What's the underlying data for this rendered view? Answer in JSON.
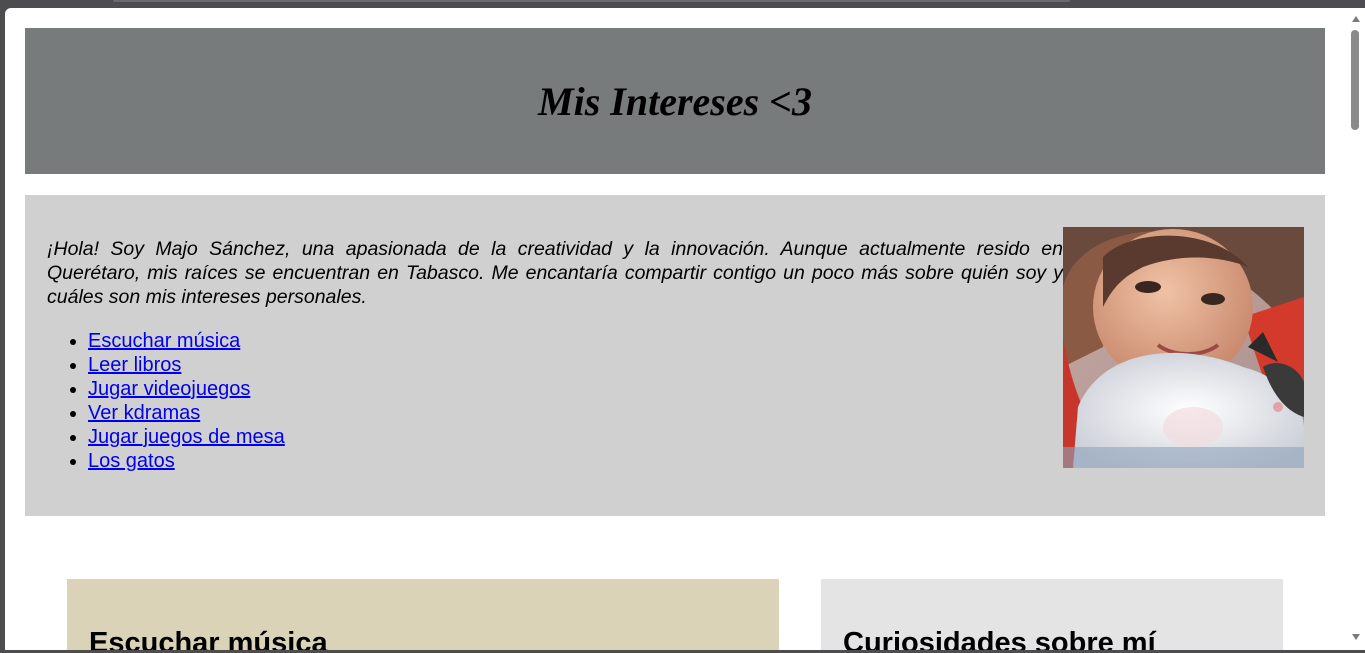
{
  "header": {
    "title": "Mis Intereses <3"
  },
  "intro": {
    "text": "¡Hola! Soy Majo Sánchez, una apasionada de la creatividad y la innovación. Aunque actualmente resido en Querétaro, mis raíces se encuentran en Tabasco. Me encantaría compartir contigo un poco más sobre quién soy y cuáles son mis intereses personales.",
    "links": [
      "Escuchar música",
      "Leer libros",
      "Jugar videojuegos",
      "Ver kdramas",
      "Jugar juegos de mesa",
      "Los gatos"
    ]
  },
  "sections": {
    "music_title": "Escuchar música",
    "curiosities_title": "Curiosidades sobre mí"
  },
  "colors": {
    "header_bg": "#787b7c",
    "intro_bg": "#d0d0d0",
    "music_card_bg": "#dbd3b7",
    "curiosities_card_bg": "#e4e4e4",
    "link": "#0000ee"
  },
  "icons": {
    "profile_photo": "photo-of-girl-with-white-cat",
    "scroll_up": "chevron-up-icon",
    "scroll_down": "chevron-down-icon"
  }
}
